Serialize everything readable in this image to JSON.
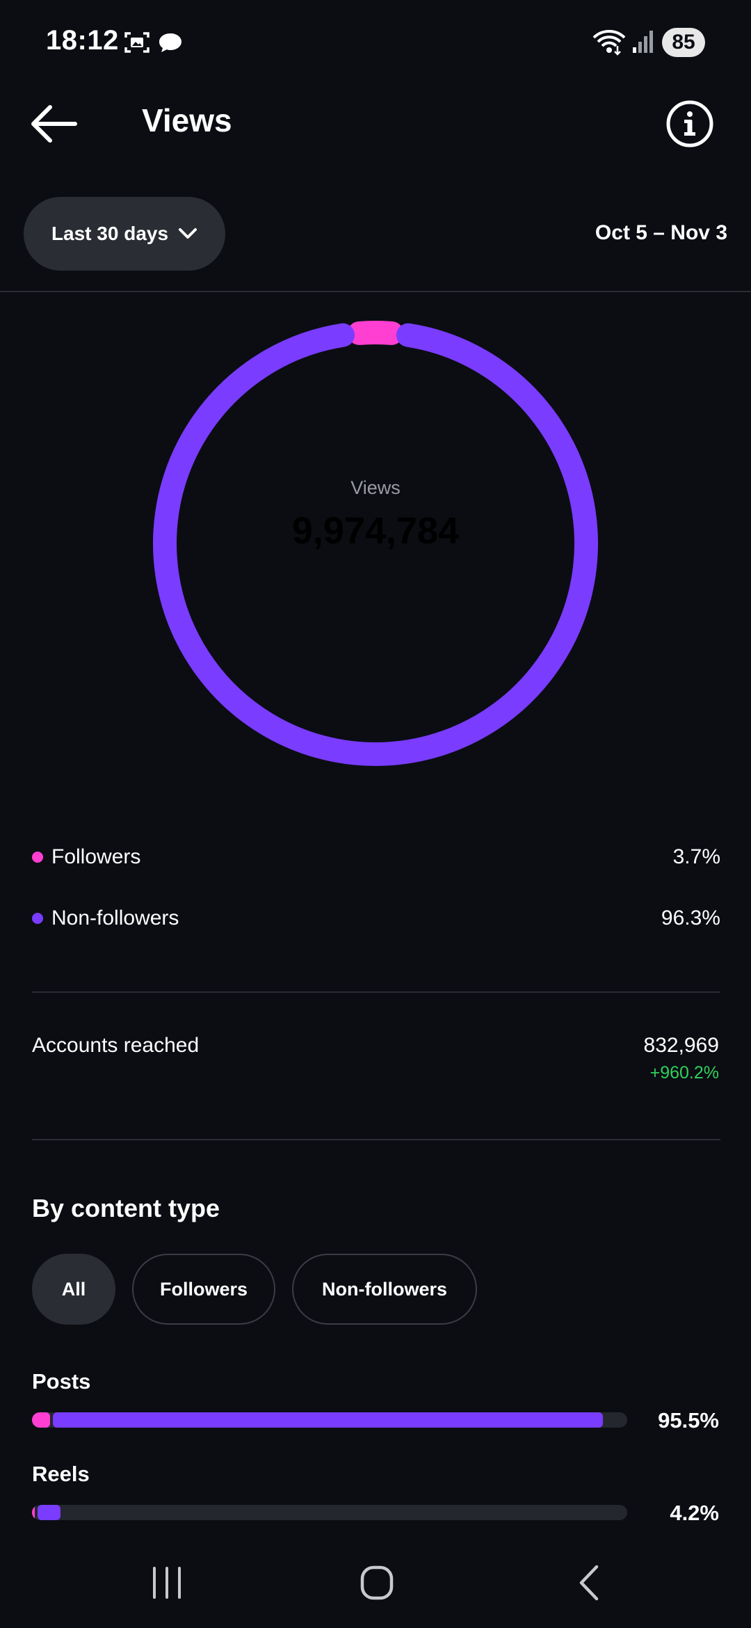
{
  "status_bar": {
    "time": "18:12",
    "battery": "85",
    "icons": [
      "screenshot-icon",
      "chat-bubble-icon",
      "wifi-icon",
      "signal-icon",
      "battery-icon"
    ]
  },
  "header": {
    "title": "Views",
    "back_icon": "arrow-left-icon",
    "info_icon": "info-icon"
  },
  "range": {
    "label": "Last 30 days",
    "dates": "Oct 5 – Nov 3"
  },
  "donut": {
    "label": "Views",
    "total": "9,974,784"
  },
  "chart_data": {
    "type": "pie",
    "categories": [
      "Followers",
      "Non-followers"
    ],
    "values": [
      3.7,
      96.3
    ],
    "colors": [
      "#ff3fd2",
      "#7a3cff"
    ],
    "center_label": "Views",
    "center_value": "9,974,784"
  },
  "legend": [
    {
      "name": "Followers",
      "value": "3.7%",
      "color": "#ff3fd2"
    },
    {
      "name": "Non-followers",
      "value": "96.3%",
      "color": "#7a3cff"
    }
  ],
  "accounts_reached": {
    "label": "Accounts reached",
    "value": "832,969",
    "change": "+960.2%"
  },
  "content_type": {
    "title": "By content type",
    "filters": [
      "All",
      "Followers",
      "Non-followers"
    ],
    "selected": "All",
    "rows": [
      {
        "label": "Posts",
        "pct": "95.5%",
        "followers_share": 3.0,
        "non_followers_share": 92.5
      },
      {
        "label": "Reels",
        "pct": "4.2%",
        "followers_share": 0.3,
        "non_followers_share": 3.9
      }
    ]
  },
  "colors": {
    "followers": "#ff3fd2",
    "non_followers": "#7a3cff",
    "positive": "#2fd15a",
    "background": "#0b0d13"
  },
  "nav": {
    "icons": [
      "recent-apps-icon",
      "home-icon",
      "back-nav-icon"
    ]
  }
}
